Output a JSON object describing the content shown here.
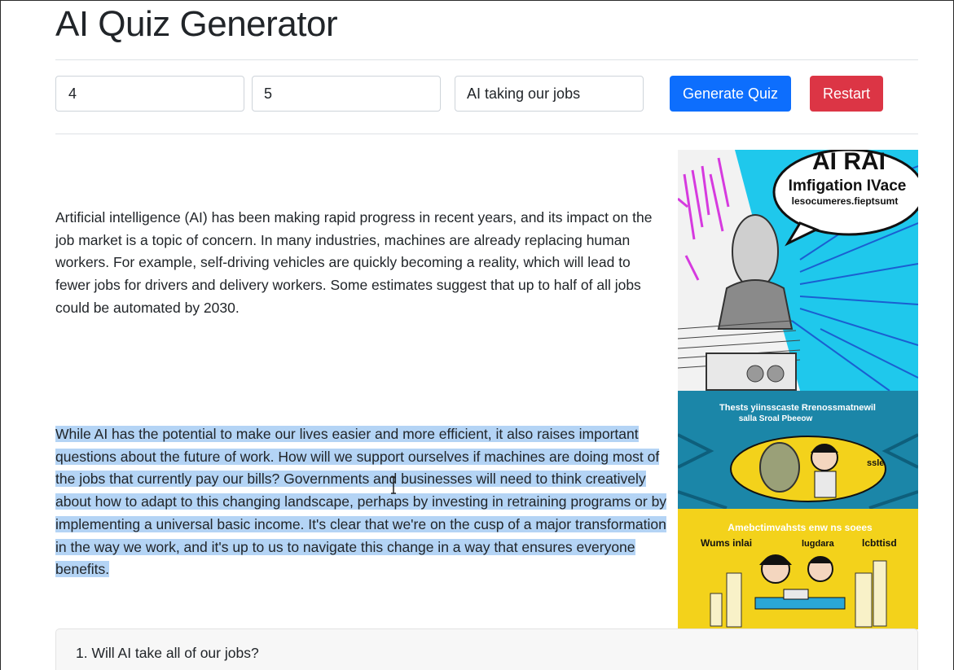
{
  "header": {
    "title": "AI Quiz Generator"
  },
  "form": {
    "field1_value": "4",
    "field2_value": "5",
    "topic_value": "AI taking our jobs",
    "generate_label": "Generate Quiz",
    "restart_label": "Restart"
  },
  "article": {
    "paragraph1": "Artificial intelligence (AI) has been making rapid progress in recent years, and its impact on the job market is a topic of concern. In many industries, machines are already replacing human workers. For example, self-driving vehicles are quickly becoming a reality, which will lead to fewer jobs for drivers and delivery workers. Some estimates suggest that up to half of all jobs could be automated by 2030.",
    "paragraph2": "While AI has the potential to make our lives easier and more efficient, it also raises important questions about the future of work. How will we support ourselves if machines are doing most of the jobs that currently pay our bills? Governments and businesses will need to think creatively about how to adapt to this changing landscape, perhaps by investing in retraining programs or by implementing a universal basic income. It's clear that we're on the cusp of a major transformation in the way we work, and it's up to us to navigate this change in a way that ensures everyone benefits."
  },
  "illustration": {
    "top_heading": "AI RAI",
    "top_sub": "Imfigation IVace",
    "top_sub2": "lesocumeres.fieptsumt",
    "mid_line1": "Thests yiinsscaste  Rrenossmatnewil",
    "mid_line2": "salla Sroal Pbeeow",
    "mid_tag": "ssle",
    "bottom_line1": "Amebctimvahsts enw ns soees",
    "bottom_left": "Wums inlai",
    "bottom_mid": "lugdara",
    "bottom_right": "lcbttisd"
  },
  "quiz": {
    "question1": "1. Will AI take all of our jobs?"
  },
  "colors": {
    "primary": "#0d6efd",
    "danger": "#dc3545",
    "selection": "#b4d4f5",
    "illus_cyan": "#17c3e6",
    "illus_yellow": "#f3d21b",
    "illus_teal": "#1b86a8"
  }
}
